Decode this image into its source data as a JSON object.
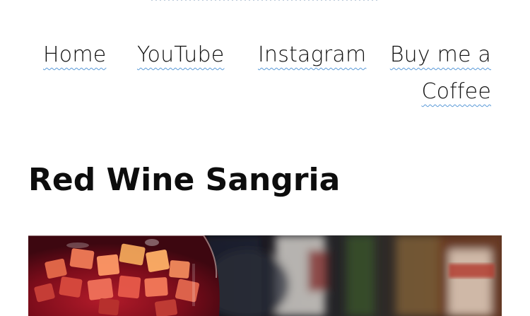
{
  "nav": {
    "home": "Home",
    "youtube": "YouTube",
    "instagram": "Instagram",
    "coffee": "Buy me a Coffee"
  },
  "article": {
    "title": "Red Wine Sangria"
  },
  "colors": {
    "link_underline": "#5a9ad8",
    "title_text": "#0d0d0d"
  }
}
